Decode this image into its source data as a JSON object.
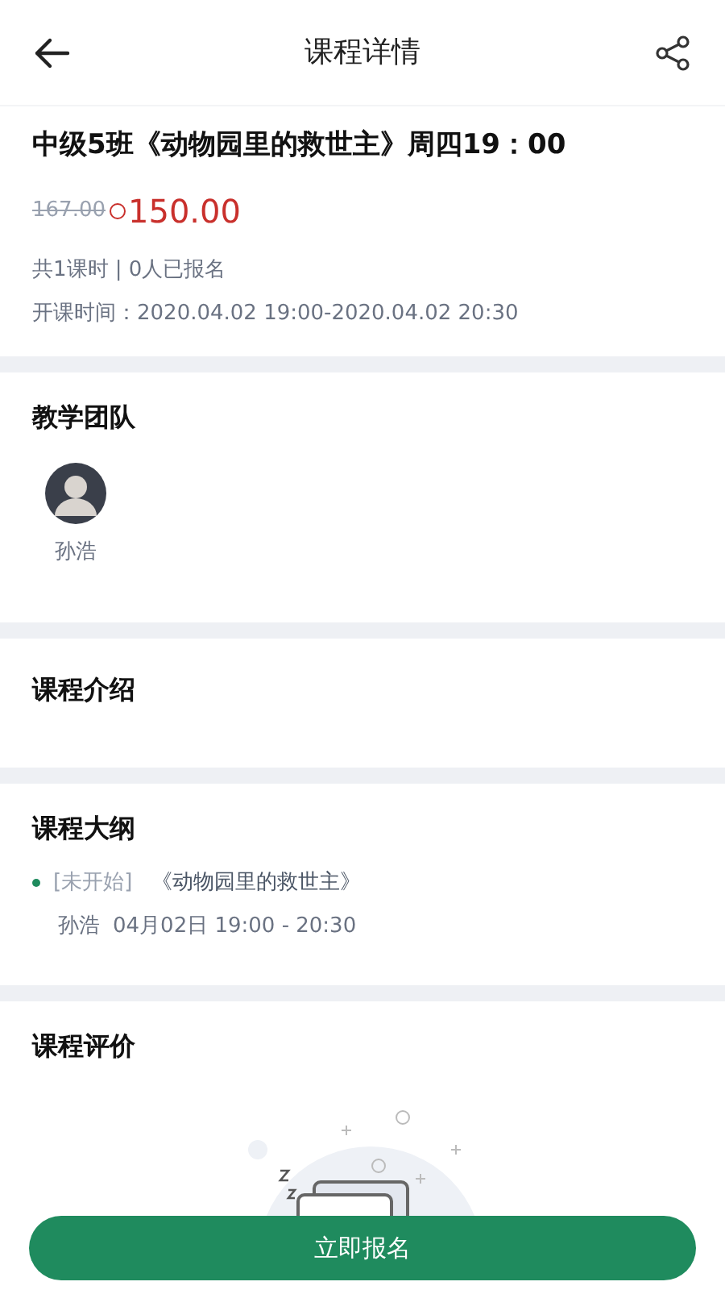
{
  "header": {
    "title": "课程详情"
  },
  "course": {
    "title": "中级5班《动物园里的救世主》周四19：00",
    "original_price": "167.00",
    "price": "150.00",
    "summary": "共1课时 | 0人已报名",
    "schedule": "开课时间：2020.04.02 19:00-2020.04.02 20:30"
  },
  "team": {
    "heading": "教学团队",
    "members": [
      {
        "name": "孙浩"
      }
    ]
  },
  "intro": {
    "heading": "课程介绍"
  },
  "outline": {
    "heading": "课程大纲",
    "lessons": [
      {
        "status": "[未开始]",
        "title": "《动物园里的救世主》",
        "teacher": "孙浩",
        "time": "04月02日 19:00 - 20:30"
      }
    ]
  },
  "reviews": {
    "heading": "课程评价"
  },
  "enroll_button": "立即报名"
}
